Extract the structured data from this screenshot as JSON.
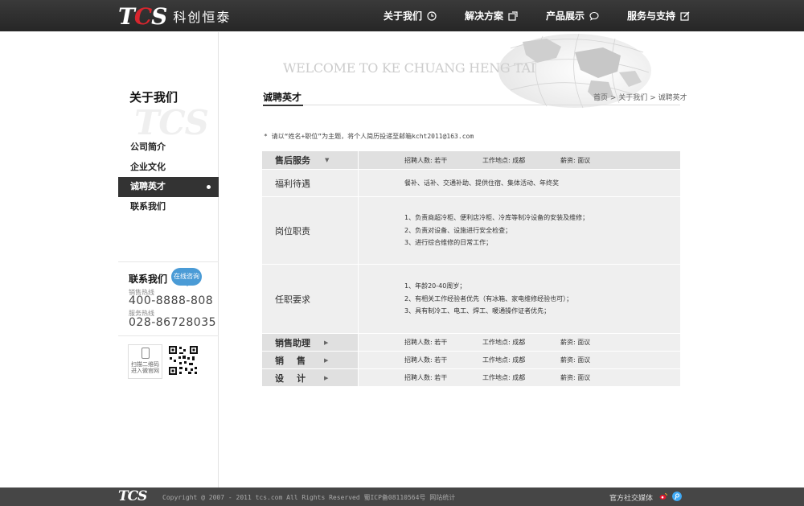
{
  "header": {
    "logo_mark": "TCS",
    "logo_text": "科创恒泰",
    "nav": [
      {
        "label": "关于我们",
        "icon": "clock-icon"
      },
      {
        "label": "解决方案",
        "icon": "external-link-icon"
      },
      {
        "label": "产品展示",
        "icon": "speech-bubble-icon"
      },
      {
        "label": "服务与支持",
        "icon": "edit-icon"
      }
    ]
  },
  "sidebar": {
    "title": "关于我们",
    "watermark": "TCS",
    "items": [
      {
        "label": "公司简介"
      },
      {
        "label": "企业文化"
      },
      {
        "label": "诚聘英才"
      },
      {
        "label": "联系我们"
      }
    ],
    "contact": {
      "title": "联系我们",
      "bubble": "在线咨询",
      "sales_label": "销售热线",
      "sales_number": "400-8888-808",
      "service_label": "服务热线",
      "service_number": "028-86728035"
    },
    "qr": {
      "phone_text_1": "扫描二维码",
      "phone_text_2": "进入微官网"
    }
  },
  "main": {
    "banner": "WELCOME TO KE CHUANG HENG TAI",
    "page_title": "诚聘英才",
    "breadcrumb": [
      "首页",
      "关于我们",
      "诚聘英才"
    ],
    "notice": "* 请以“姓名+职位”为主题，将个人简历投递至邮箱kcht2011@163.com",
    "jobs": [
      {
        "name": "售后服务",
        "headcount_label": "招聘人数:",
        "headcount": "若干",
        "location_label": "工作地点:",
        "location": "成都",
        "salary_label": "薪资:",
        "salary": "面议",
        "benefits_label": "福利待遇",
        "benefits": "餐补、话补、交通补助、提供住宿、集体活动、年终奖",
        "duties_label": "岗位职责",
        "duties": [
          "1、负责商超冷柜、便利店冷柜、冷库等制冷设备的安装及维修；",
          "2、负责对设备、设施进行安全检查；",
          "3、进行综合维修的日常工作；"
        ],
        "requirements_label": "任职要求",
        "requirements": [
          "1、年龄20-40周岁；",
          "2、有相关工作经验者优先（有冰箱、家电维修经验也可）；",
          "3、具有制冷工、电工、焊工、暖通操作证者优先；"
        ]
      },
      {
        "name": "销售助理",
        "headcount_label": "招聘人数:",
        "headcount": "若干",
        "location_label": "工作地点:",
        "location": "成都",
        "salary_label": "薪资:",
        "salary": "面议"
      },
      {
        "name": "销售",
        "headcount_label": "招聘人数:",
        "headcount": "若干",
        "location_label": "工作地点:",
        "location": "成都",
        "salary_label": "薪资:",
        "salary": "面议"
      },
      {
        "name": "设计",
        "headcount_label": "招聘人数:",
        "headcount": "若干",
        "location_label": "工作地点:",
        "location": "成都",
        "salary_label": "薪资:",
        "salary": "面议"
      }
    ]
  },
  "footer": {
    "logo": "TCS",
    "copyright": "Copyright @ 2007 - 2011 tcs.com All Rights Reserved 蜀ICP备08110564号 网站统计",
    "social_label": "官方社交媒体",
    "social_icons": [
      "weibo-icon",
      "tencent-weibo-icon"
    ]
  }
}
